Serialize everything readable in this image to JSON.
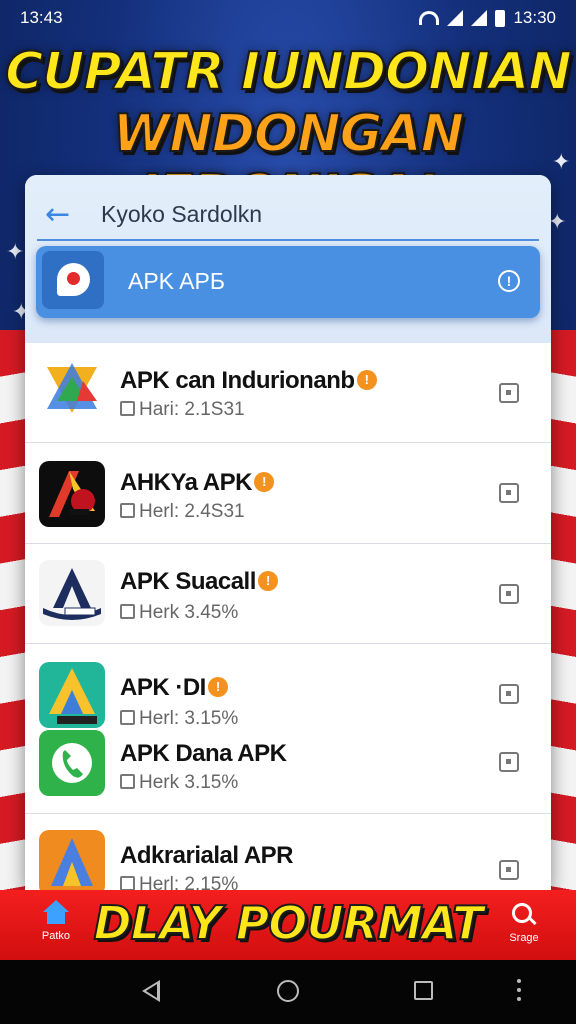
{
  "status_bar": {
    "time_left": "13:43",
    "time_right": "13:30"
  },
  "headline": {
    "line1": "CUPATR IUNDONIAN",
    "line2": "WNDONGAN IEDONISA!",
    "colors": {
      "line1": "#ffe61a",
      "line2": "#ffa21a"
    }
  },
  "toolbar": {
    "title": "Kyoko Sardolkn",
    "back_icon": "back-arrow-icon"
  },
  "search": {
    "label": "APK APБ",
    "info_icon": "info-icon",
    "logo_icon": "app-logo-icon"
  },
  "apps": [
    {
      "name": "APK can Indurionanb",
      "badge": "!",
      "meta": "Hari: 2.1S31"
    },
    {
      "name": "AHKYa APK",
      "badge": "!",
      "meta": "Herl: 2.4S31"
    },
    {
      "name": "APK Suacall",
      "badge": "!",
      "meta": "Herk 3.45%"
    },
    {
      "name": "APK ·DI",
      "badge": "!",
      "meta": "Herl: 3.15%"
    },
    {
      "name": "APK Dana APK",
      "badge": "",
      "meta": "Herk 3.15%"
    },
    {
      "name": "Adkrarialal APR",
      "badge": "",
      "meta": "Herl: 2.15%"
    }
  ],
  "bottom_banner": {
    "home_label": "Patko",
    "title": "DLAY POURMAT",
    "search_label": "Srage",
    "color": "#e51515"
  },
  "nav": {
    "back": "nav-back-icon",
    "home": "nav-home-icon",
    "recents": "nav-recents-icon",
    "more": "nav-more-icon"
  }
}
